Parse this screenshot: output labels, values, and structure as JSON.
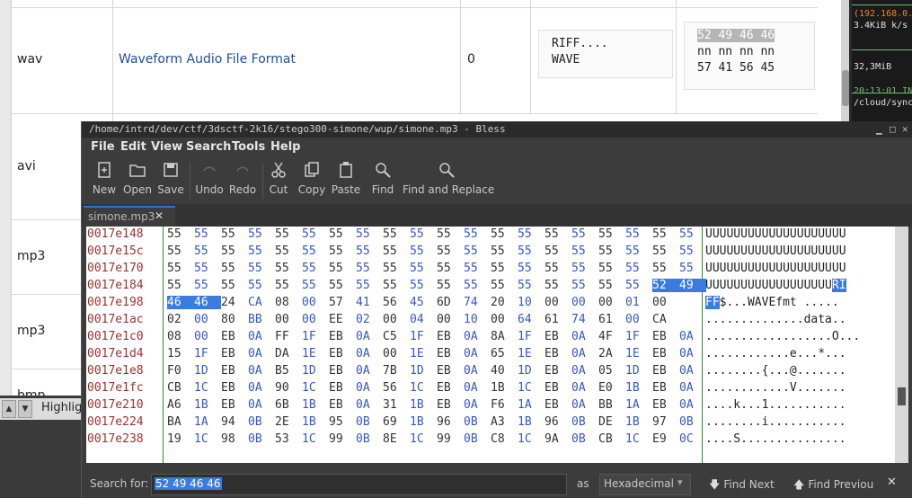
{
  "bg_table": {
    "rows": [
      {
        "ext": "wav",
        "format": "Waveform Audio File Format",
        "offset": "0",
        "ascii": [
          "RIFF....",
          "WAVE"
        ],
        "hex": [
          "52 49 46 46",
          "nn nn nn nn",
          "57 41 56 45"
        ]
      },
      {
        "ext": "avi"
      },
      {
        "ext": "mp3"
      },
      {
        "ext": "mp3"
      },
      {
        "ext": "bmp"
      }
    ],
    "find_label": "Highlight"
  },
  "terminal": {
    "lines": [
      "(192.168.0.",
      "3.4KiB k/s",
      "32,3MiB",
      "20:13:01 IN",
      "/cloud/sync"
    ]
  },
  "window": {
    "title": "/home/intrd/dev/ctf/3dsctf-2k16/stego300-simone/wup/simone.mp3 - Bless",
    "menu": [
      "File",
      "Edit",
      "View",
      "Search",
      "Tools",
      "Help"
    ],
    "toolbar": [
      {
        "label": "New",
        "icon": "new-file-icon"
      },
      {
        "label": "Open",
        "icon": "open-folder-icon"
      },
      {
        "label": "Save",
        "icon": "save-icon"
      },
      {
        "label": "Undo",
        "icon": "undo-icon"
      },
      {
        "label": "Redo",
        "icon": "redo-icon"
      },
      {
        "label": "Cut",
        "icon": "scissors-icon"
      },
      {
        "label": "Copy",
        "icon": "copy-icon"
      },
      {
        "label": "Paste",
        "icon": "paste-icon"
      },
      {
        "label": "Find",
        "icon": "magnifier-icon"
      },
      {
        "label": "Find and Replace",
        "icon": "find-replace-icon"
      }
    ],
    "tab": "simone.mp3"
  },
  "hex": {
    "rows": [
      {
        "offset": "0017e148",
        "bytes": "55 55 55 55 55 55 55 55 55 55 55 55 55 55 55 55 55 55 55 55",
        "ascii": "UUUUUUUUUUUUUUUUUUUU"
      },
      {
        "offset": "0017e15c",
        "bytes": "55 55 55 55 55 55 55 55 55 55 55 55 55 55 55 55 55 55 55 55",
        "ascii": "UUUUUUUUUUUUUUUUUUUU"
      },
      {
        "offset": "0017e170",
        "bytes": "55 55 55 55 55 55 55 55 55 55 55 55 55 55 55 55 55 55 55 55",
        "ascii": "UUUUUUUUUUUUUUUUUUUU"
      },
      {
        "offset": "0017e184",
        "bytes": "55 55 55 55 55 55 55 55 55 55 55 55 55 55 55 55 55 55 52 49",
        "ascii": "UUUUUUUUUUUUUUUUUURI",
        "hl": [
          18,
          19
        ]
      },
      {
        "offset": "0017e198",
        "bytes": "46 46 24 CA 08 00 57 41 56 45 6D 74 20 10 00 00 00 01 00",
        "ascii": "FF$...WAVEfmt .....",
        "hl": [
          0,
          1
        ]
      },
      {
        "offset": "0017e1ac",
        "bytes": "02 00 80 BB 00 00 EE 02 00 04 00 10 00 64 61 74 61 00 CA",
        "ascii": "..............data.."
      },
      {
        "offset": "0017e1c0",
        "bytes": "08 00 EB 0A FF 1F EB 0A C5 1F EB 0A 8A 1F EB 0A 4F 1F EB 0A",
        "ascii": "..................O..."
      },
      {
        "offset": "0017e1d4",
        "bytes": "15 1F EB 0A DA 1E EB 0A 00 1E EB 0A 65 1E EB 0A 2A 1E EB 0A",
        "ascii": "............e...*..."
      },
      {
        "offset": "0017e1e8",
        "bytes": "F0 1D EB 0A B5 1D EB 0A 7B 1D EB 0A 40 1D EB 0A 05 1D EB 0A",
        "ascii": "........{...@......."
      },
      {
        "offset": "0017e1fc",
        "bytes": "CB 1C EB 0A 90 1C EB 0A 56 1C EB 0A 1B 1C EB 0A E0 1B EB 0A",
        "ascii": "............V......."
      },
      {
        "offset": "0017e210",
        "bytes": "A6 1B EB 0A 6B 1B EB 0A 31 1B EB 0A F6 1A EB 0A BB 1A EB 0A",
        "ascii": "....k...1..........."
      },
      {
        "offset": "0017e224",
        "bytes": "BA 1A 94 0B 2E 1B 95 0B 69 1B 96 0B A3 1B 96 0B DE 1B 97 0B",
        "ascii": "........i..........."
      },
      {
        "offset": "0017e238",
        "bytes": "19 1C 98 0B 53 1C 99 0B 8E 1C 99 0B C8 1C 9A 0B CB 1C E9 0C",
        "ascii": "....S..............."
      }
    ]
  },
  "search": {
    "label": "Search for:",
    "value": "52 49 46 46",
    "as_label": "as",
    "type": "Hexadecimal",
    "find_next": "Find Next",
    "find_prev": "Find Previou"
  }
}
